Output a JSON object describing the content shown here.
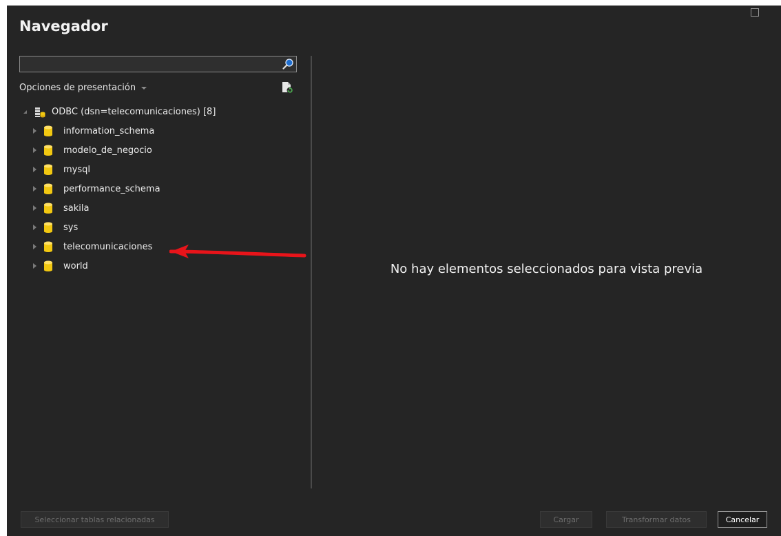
{
  "window": {
    "title": "Navegador"
  },
  "search": {
    "value": "",
    "placeholder": ""
  },
  "options": {
    "label": "Opciones de presentación"
  },
  "tree": {
    "root_label": "ODBC (dsn=telecomunicaciones) [8]",
    "items": [
      {
        "label": "information_schema"
      },
      {
        "label": "modelo_de_negocio"
      },
      {
        "label": "mysql"
      },
      {
        "label": "performance_schema"
      },
      {
        "label": "sakila"
      },
      {
        "label": "sys"
      },
      {
        "label": "telecomunicaciones"
      },
      {
        "label": "world"
      }
    ]
  },
  "preview": {
    "message": "No hay elementos seleccionados para vista previa"
  },
  "footer": {
    "related_tables_label": "Seleccionar tablas relacionadas",
    "load_label": "Cargar",
    "transform_label": "Transformar datos",
    "cancel_label": "Cancelar"
  },
  "colors": {
    "background": "#252525",
    "db_icon": "#f2c811",
    "annotation_arrow": "#e8141a",
    "disabled_text": "#6e6e6e"
  },
  "icons": {
    "search": "search-icon",
    "refresh": "refresh-icon",
    "odbc": "odbc-source-icon",
    "database": "database-icon"
  }
}
